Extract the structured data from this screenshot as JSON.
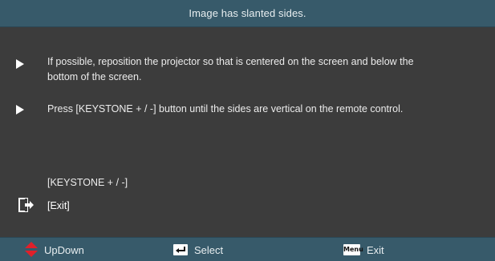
{
  "window": {
    "title": "Image has slanted sides."
  },
  "instructions": [
    {
      "line1": "If possible, reposition the projector so that is centered on the screen and below the",
      "line2": "bottom of the screen."
    },
    {
      "line1": "Press [KEYSTONE + / -] button until the sides are vertical on the remote control."
    }
  ],
  "menu": {
    "keystone_label": "[KEYSTONE + / -]",
    "exit_label": "[Exit]",
    "selected_icon": "exit-arrow-icon"
  },
  "footer": {
    "updown": {
      "icon": "up-down-arrows-icon",
      "label": "UpDown",
      "icon_color": "#e0202a"
    },
    "select": {
      "icon": "enter-key-icon",
      "label": "Select"
    },
    "exit": {
      "icon": "menu-key-icon",
      "key_text": "Menu",
      "label": "Exit"
    }
  },
  "colors": {
    "bar": "#375a6a",
    "panel": "#3c3c3c",
    "text": "#ececec",
    "accent_red": "#e0202a"
  }
}
